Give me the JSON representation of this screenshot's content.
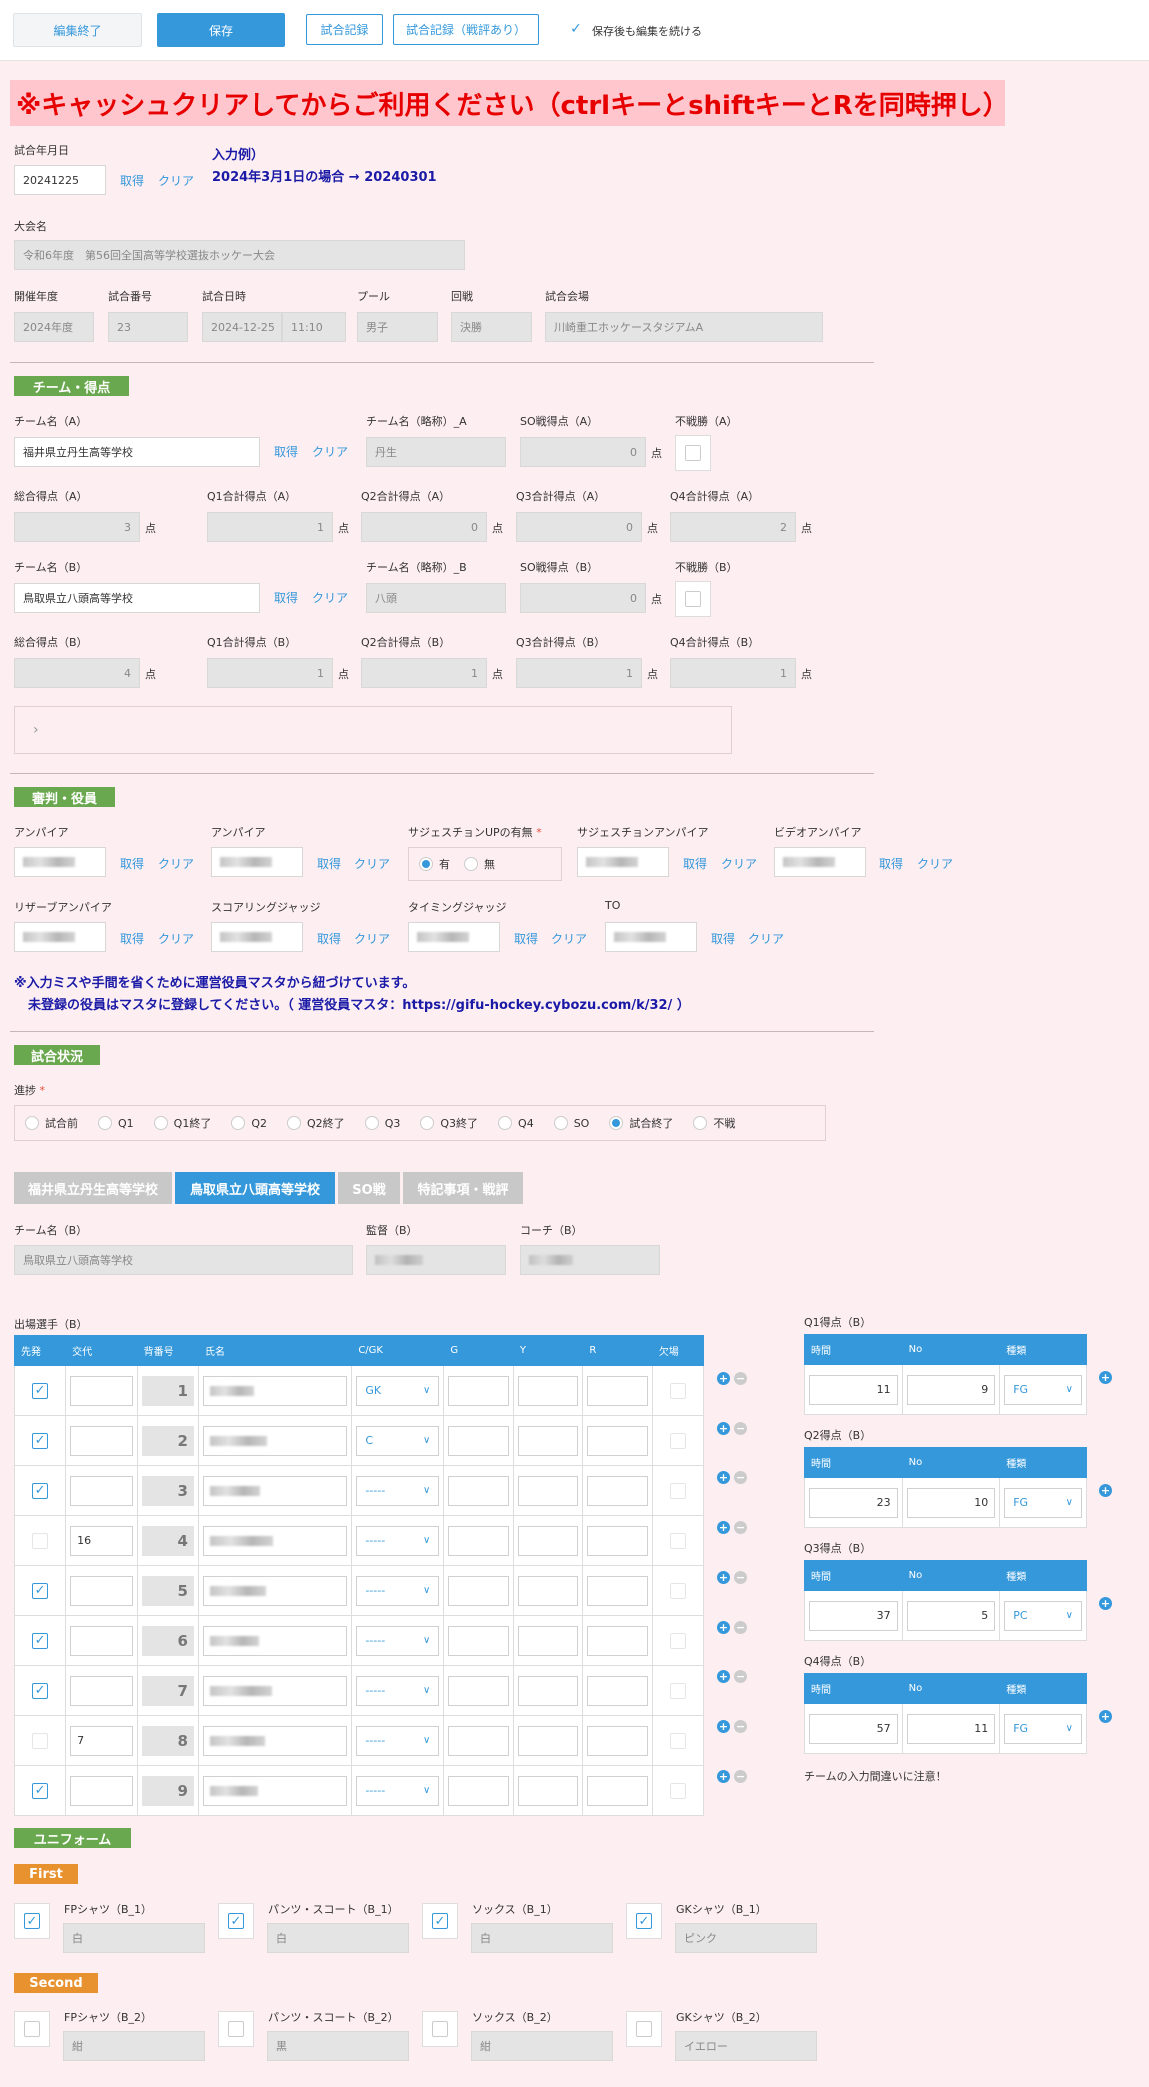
{
  "toolbar": {
    "finish_edit": "編集終了",
    "save": "保存",
    "record": "試合記録",
    "record_review": "試合記録（戦評あり）",
    "keep_editing": "保存後も編集を続ける"
  },
  "banner": "※キャッシュクリアしてからご利用ください（ctrlキーとshiftキーとRを同時押し）",
  "match_date": {
    "label": "試合年月日",
    "value": "20241225",
    "get": "取得",
    "clear": "クリア",
    "example_title": "入力例）",
    "example_text": "2024年3月1日の場合 → 20240301"
  },
  "tournament": {
    "label": "大会名",
    "value": "令和6年度　第56回全国高等学校選抜ホッケー大会"
  },
  "meta": {
    "labels": [
      "開催年度",
      "試合番号",
      "試合日時",
      "プール",
      "回戦",
      "試合会場"
    ],
    "year": "2024年度",
    "number": "23",
    "date": "2024-12-25",
    "time": "11:10",
    "pool": "男子",
    "round": "決勝",
    "venue": "川崎重工ホッケースタジアムA"
  },
  "sections": {
    "team_score": "チーム・得点",
    "officials": "審判・役員",
    "status": "試合状況",
    "uniform": "ユニフォーム",
    "first": "First",
    "second": "Second"
  },
  "unit": "点",
  "team_a": {
    "name_label": "チーム名（A）",
    "name": "福井県立丹生高等学校",
    "short_label": "チーム名（略称）_A",
    "short": "丹生",
    "so_label": "SO戦得点（A）",
    "so": "0",
    "forfeit_label": "不戦勝（A）",
    "total_label": "総合得点（A）",
    "total": "3",
    "q_labels": [
      "Q1合計得点（A）",
      "Q2合計得点（A）",
      "Q3合計得点（A）",
      "Q4合計得点（A）"
    ],
    "q": [
      "1",
      "0",
      "0",
      "2"
    ]
  },
  "team_b": {
    "name_label": "チーム名（B）",
    "name": "鳥取県立八頭高等学校",
    "short_label": "チーム名（略称）_B",
    "short": "八頭",
    "so_label": "SO戦得点（B）",
    "so": "0",
    "forfeit_label": "不戦勝（B）",
    "total_label": "総合得点（B）",
    "total": "4",
    "q_labels": [
      "Q1合計得点（B）",
      "Q2合計得点（B）",
      "Q3合計得点（B）",
      "Q4合計得点（B）"
    ],
    "q": [
      "1",
      "1",
      "1",
      "1"
    ]
  },
  "officials": {
    "umpire1": "アンパイア",
    "umpire2": "アンパイア",
    "suggestion_up": "サジェスチョンUPの有無",
    "required": "*",
    "yes": "有",
    "no": "無",
    "suggestion_umpire": "サジェスチョンアンパイア",
    "video_umpire": "ビデオアンパイア",
    "reserve_umpire": "リザーブアンパイア",
    "scoring_judge": "スコアリングジャッジ",
    "timing_judge": "タイミングジャッジ",
    "to": "TO",
    "get": "取得",
    "clear": "クリア",
    "note1": "※入力ミスや手間を省くために運営役員マスタから紐づけています。",
    "note2": "未登録の役員はマスタに登録してください。（ 運営役員マスタ：https://gifu-hockey.cybozu.com/k/32/ ）"
  },
  "status": {
    "label": "進捗",
    "options": [
      "試合前",
      "Q1",
      "Q1終了",
      "Q2",
      "Q2終了",
      "Q3",
      "Q3終了",
      "Q4",
      "SO",
      "試合終了",
      "不戦"
    ],
    "selected": "試合終了"
  },
  "tabs": [
    "福井県立丹生高等学校",
    "鳥取県立八頭高等学校",
    "SO戦",
    "特記事項・戦評"
  ],
  "team_detail": {
    "name_label": "チーム名（B）",
    "name": "鳥取県立八頭高等学校",
    "coach_label": "監督（B）",
    "assistant_label": "コーチ（B）"
  },
  "players": {
    "label": "出場選手（B）",
    "headers": [
      "先発",
      "交代",
      "背番号",
      "氏名",
      "C/GK",
      "G",
      "Y",
      "R",
      "欠場"
    ],
    "rows": [
      {
        "starter": true,
        "sub": "",
        "num": "1",
        "role": "GK"
      },
      {
        "starter": true,
        "sub": "",
        "num": "2",
        "role": "C"
      },
      {
        "starter": true,
        "sub": "",
        "num": "3",
        "role": "-----"
      },
      {
        "starter": false,
        "sub": "16",
        "num": "4",
        "role": "-----"
      },
      {
        "starter": true,
        "sub": "",
        "num": "5",
        "role": "-----"
      },
      {
        "starter": true,
        "sub": "",
        "num": "6",
        "role": "-----"
      },
      {
        "starter": true,
        "sub": "",
        "num": "7",
        "role": "-----"
      },
      {
        "starter": false,
        "sub": "7",
        "num": "8",
        "role": "-----"
      },
      {
        "starter": true,
        "sub": "",
        "num": "9",
        "role": "-----"
      }
    ]
  },
  "goals": {
    "headers": [
      "時間",
      "No",
      "種類"
    ],
    "tables": [
      {
        "label": "Q1得点（B）",
        "time": "11",
        "no": "9",
        "type": "FG"
      },
      {
        "label": "Q2得点（B）",
        "time": "23",
        "no": "10",
        "type": "FG"
      },
      {
        "label": "Q3得点（B）",
        "time": "37",
        "no": "5",
        "type": "PC"
      },
      {
        "label": "Q4得点（B）",
        "time": "57",
        "no": "11",
        "type": "FG"
      }
    ],
    "warning": "チームの入力間違いに注意！"
  },
  "uniform": {
    "first": [
      {
        "label": "FPシャツ（B_1）",
        "value": "白",
        "checked": true
      },
      {
        "label": "パンツ・スコート（B_1）",
        "value": "白",
        "checked": true
      },
      {
        "label": "ソックス（B_1）",
        "value": "白",
        "checked": true
      },
      {
        "label": "GKシャツ（B_1）",
        "value": "ピンク",
        "checked": true
      }
    ],
    "second": [
      {
        "label": "FPシャツ（B_2）",
        "value": "紺",
        "checked": false
      },
      {
        "label": "パンツ・スコート（B_2）",
        "value": "黒",
        "checked": false
      },
      {
        "label": "ソックス（B_2）",
        "value": "紺",
        "checked": false
      },
      {
        "label": "GKシャツ（B_2）",
        "value": "イエロー",
        "checked": false
      }
    ]
  },
  "colors": {
    "accent": "#3498db",
    "section": "#6aa84f",
    "banner_text": "#e60000"
  }
}
